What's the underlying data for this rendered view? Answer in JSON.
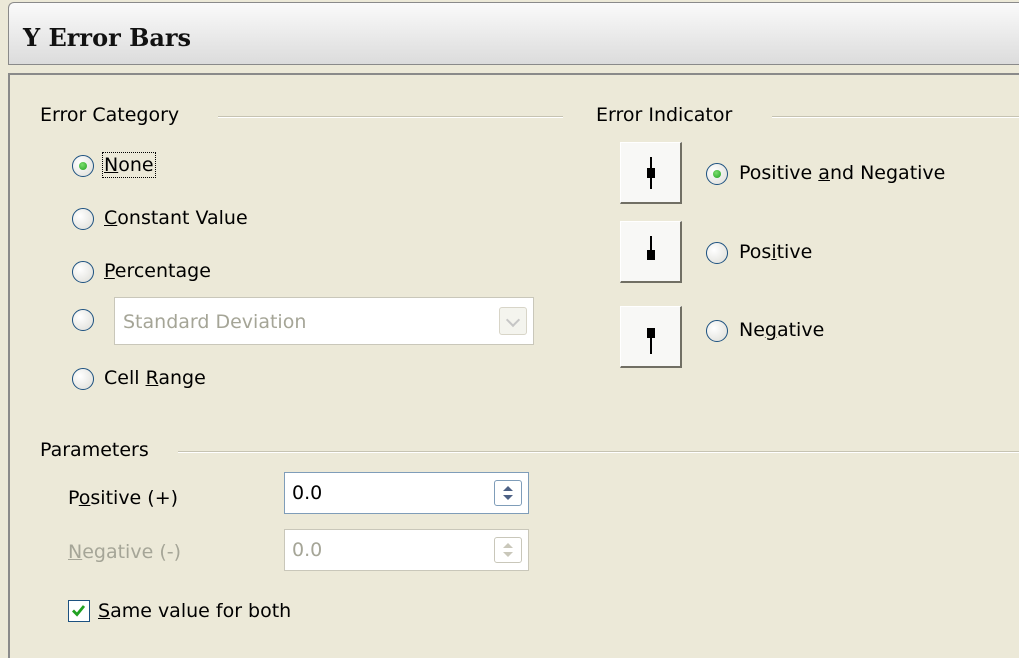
{
  "dialog": {
    "title": "Y Error Bars"
  },
  "error_category": {
    "heading": "Error Category",
    "none": {
      "pre": "",
      "mnemonic": "N",
      "post": "one",
      "selected": true
    },
    "constant": {
      "pre": "",
      "mnemonic": "C",
      "post": "onstant Value",
      "selected": false
    },
    "percentage": {
      "pre": "",
      "mnemonic": "P",
      "post": "ercentage",
      "selected": false
    },
    "function_select": {
      "value": "Standard Deviation",
      "enabled": false
    },
    "cell_range": {
      "pre": "Cell ",
      "mnemonic": "R",
      "post": "ange",
      "selected": false
    }
  },
  "error_indicator": {
    "heading": "Error Indicator",
    "pos_neg": {
      "pre": "Positive ",
      "mnemonic": "a",
      "post": "nd Negative",
      "selected": true,
      "icon": "error-bar-both-icon"
    },
    "positive": {
      "pre": "Pos",
      "mnemonic": "i",
      "post": "tive",
      "selected": false,
      "icon": "error-bar-positive-icon"
    },
    "negative": {
      "pre": "Ne",
      "mnemonic": "g",
      "post": "ative",
      "selected": false,
      "icon": "error-bar-negative-icon"
    }
  },
  "parameters": {
    "heading": "Parameters",
    "positive": {
      "pre": "P",
      "mnemonic": "o",
      "post": "sitive (+)",
      "value": "0.0",
      "enabled": true
    },
    "negative": {
      "pre": "",
      "mnemonic": "N",
      "post": "egative (-)",
      "value": "0.0",
      "enabled": false
    },
    "same_value": {
      "pre": "",
      "mnemonic": "S",
      "post": "ame value for both",
      "checked": true
    }
  },
  "colors": {
    "accent": "#1c5180",
    "radio_dot": "#21a121",
    "check": "#21a121",
    "disabled_text": "#a5a597"
  }
}
